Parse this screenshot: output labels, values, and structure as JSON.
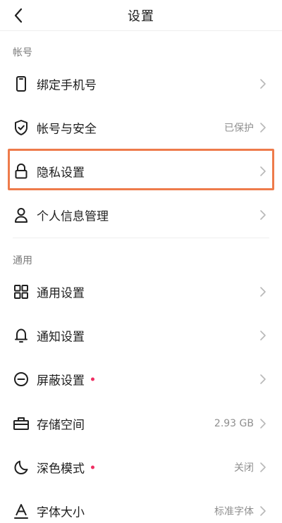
{
  "header": {
    "title": "设置"
  },
  "sections": {
    "account": {
      "label": "帐号",
      "items": [
        {
          "label": "绑定手机号",
          "value": ""
        },
        {
          "label": "帐号与安全",
          "value": "已保护"
        },
        {
          "label": "隐私设置",
          "value": ""
        },
        {
          "label": "个人信息管理",
          "value": ""
        }
      ]
    },
    "general": {
      "label": "通用",
      "items": [
        {
          "label": "通用设置",
          "value": ""
        },
        {
          "label": "通知设置",
          "value": ""
        },
        {
          "label": "屏蔽设置",
          "value": ""
        },
        {
          "label": "存储空间",
          "value": "2.93 GB"
        },
        {
          "label": "深色模式",
          "value": "关闭"
        },
        {
          "label": "字体大小",
          "value": "标准字体"
        }
      ]
    }
  },
  "colors": {
    "highlight_border": "#ee7b4b",
    "notification_dot": "#ef2e62"
  }
}
